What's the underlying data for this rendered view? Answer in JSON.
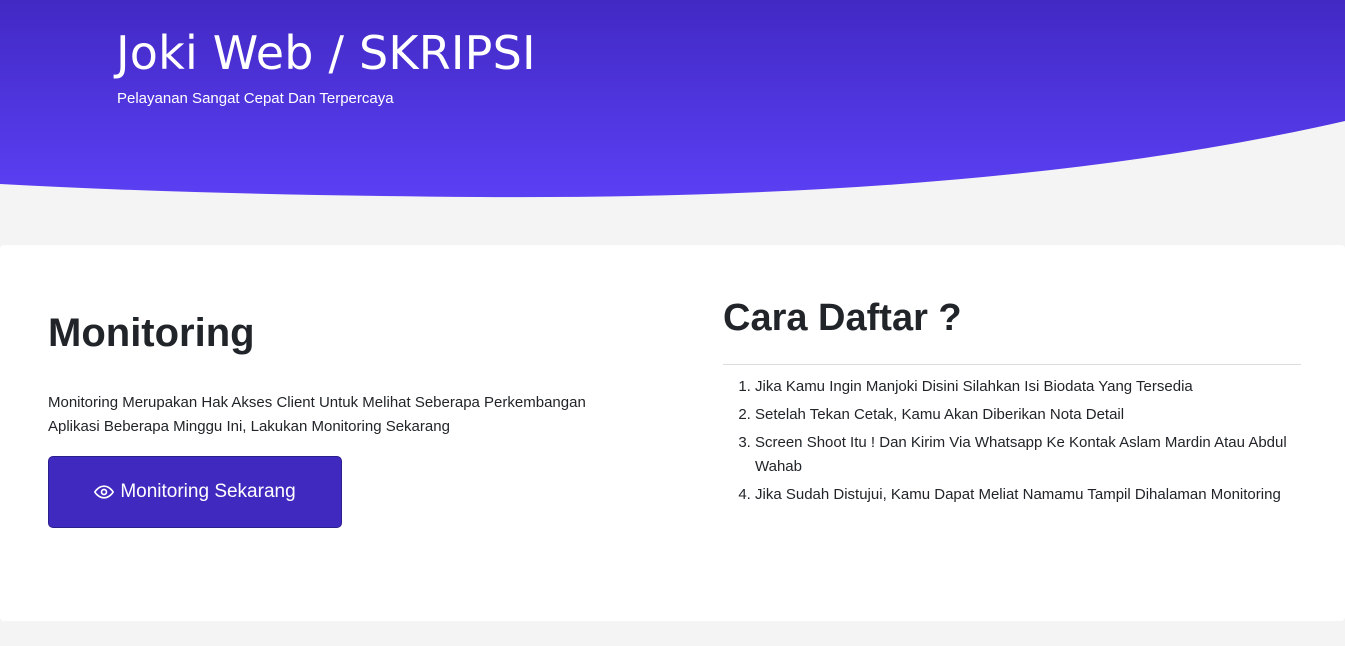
{
  "hero": {
    "title": "Joki Web / SKRIPSI",
    "subtitle": "Pelayanan Sangat Cepat Dan Terpercaya",
    "gradient_top": "#4229c4",
    "gradient_bottom": "#5a40f3"
  },
  "monitoring": {
    "title": "Monitoring",
    "description": "Monitoring Merupakan Hak Akses Client Untuk Melihat Seberapa Perkembangan Aplikasi Beberapa Minggu Ini, Lakukan Monitoring Sekarang",
    "button_label": "Monitoring Sekarang",
    "button_icon": "eye-icon",
    "button_color": "#4029bf"
  },
  "register": {
    "title": "Cara Daftar ?",
    "steps": [
      "Jika Kamu Ingin Manjoki Disini Silahkan Isi Biodata Yang Tersedia",
      "Setelah Tekan Cetak, Kamu Akan Diberikan Nota Detail",
      "Screen Shoot Itu ! Dan Kirim Via Whatsapp Ke Kontak Aslam Mardin Atau Abdul Wahab",
      "Jika Sudah Distujui, Kamu Dapat Meliat Namamu Tampil Dihalaman Monitoring"
    ]
  },
  "colors": {
    "page_background": "#f4f4f4",
    "card_background": "#ffffff"
  }
}
